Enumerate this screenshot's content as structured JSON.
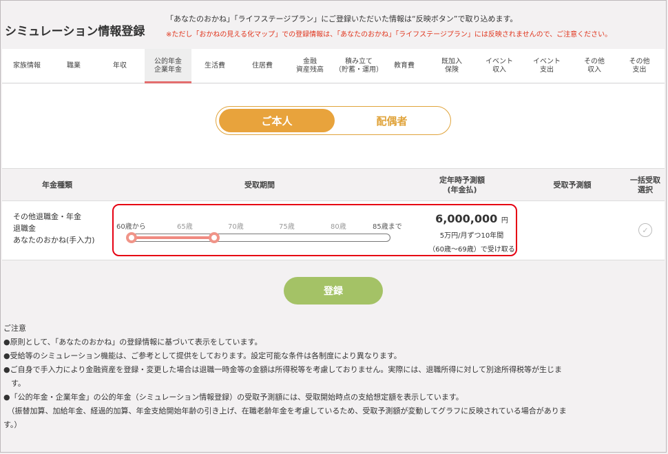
{
  "header": {
    "title": "シミュレーション情報登録",
    "line1": "「あなたのおかね」「ライフステージプラン」にご登録いただいた情報は“反映ボタン”で取り込めます。",
    "line2": "※ただし「おかねの見える化マップ」での登録情報は、「あなたのおかね」「ライフステージプラン」には反映されませんので、ご注意ください。"
  },
  "tabs": [
    {
      "label": "家族情報"
    },
    {
      "label": "職業"
    },
    {
      "label": "年収"
    },
    {
      "label": "公的年金\n企業年金",
      "active": true
    },
    {
      "label": "生活費"
    },
    {
      "label": "住居費"
    },
    {
      "label": "金融\n資産残高"
    },
    {
      "label": "積み立て\n（貯蓄・運用）"
    },
    {
      "label": "教育費"
    },
    {
      "label": "既加入\n保険"
    },
    {
      "label": "イベント\n収入"
    },
    {
      "label": "イベント\n支出"
    },
    {
      "label": "その他\n収入"
    },
    {
      "label": "その他\n支出"
    }
  ],
  "toggle": {
    "selected": "ご本人",
    "other": "配偶者"
  },
  "table": {
    "headers": {
      "type": "年金種類",
      "period": "受取期間",
      "retire_est": "定年時予測額\n(年金払)",
      "receive_est": "受取予測額",
      "bulk": "一括受取\n選択"
    },
    "row": {
      "type_line1": "その他退職金・年金",
      "type_line2": "退職金",
      "type_line3": "あなたのおかね(手入力)",
      "ticks": [
        "60歳から",
        "65歳",
        "70歳",
        "75歳",
        "80歳",
        "85歳まで"
      ],
      "range_start_age": 60,
      "range_end_age": 70,
      "axis_min": 60,
      "axis_max": 85,
      "amount": "6,000,000",
      "amount_unit": "円",
      "detail1": "5万円/月ずつ10年間",
      "detail2": "（60歳〜69歳）で受け取る"
    }
  },
  "register_label": "登録",
  "notes": [
    "ご注意",
    "●原則として、「あなたのおかね」の登録情報に基づいて表示をしています。",
    "●受給等のシミュレーション機能は、ご参考として提供をしております。設定可能な条件は各制度により異なります。",
    "●ご自身で手入力により金融資産を登録・変更した場合は退職一時金等の金額は所得税等を考慮しておりません。実際には、退職所得に対して別途所得税等が生じま",
    "　す。",
    "●「公的年金・企業年金」の公的年金（シミュレーション情報登録）の受取予測額には、受取開始時点の支給想定額を表示しています。",
    "　（振替加算、加給年金、経過的加算、年金支給開始年齢の引き上げ、在職老齢年金を考慮しているため、受取予測額が変動してグラフに反映されている場合がありま",
    "す。）"
  ]
}
